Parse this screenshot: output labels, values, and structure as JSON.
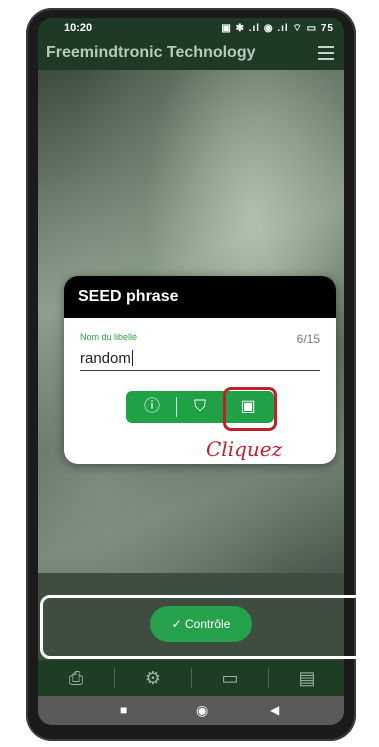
{
  "status_bar": {
    "time": "10:20",
    "icons_text": "▣ ✱ .ıl ◉ .ıl ⌔ ▭ 75"
  },
  "app_bar": {
    "title": "Freemindtronic Technology",
    "menu_icon": "hamburger-menu-icon"
  },
  "dialog": {
    "title": "SEED phrase",
    "field_label": "Nom du libellé",
    "field_counter": "6/15",
    "field_value": "random",
    "buttons": [
      {
        "icon": "info-icon",
        "glyph": "ⓘ"
      },
      {
        "icon": "shield-check-icon",
        "glyph": "⛉"
      },
      {
        "icon": "save-icon",
        "glyph": "▣"
      }
    ]
  },
  "annotation": {
    "text": "Cliquez",
    "color": "#c0202a"
  },
  "controle_button": {
    "label": "Contrôle",
    "icon": "checkmark-icon",
    "glyph": "✓"
  },
  "bottom_nav": [
    {
      "icon": "printer-icon",
      "glyph": "⎙"
    },
    {
      "icon": "gear-icon",
      "glyph": "⚙"
    },
    {
      "icon": "devices-icon",
      "glyph": "▭"
    },
    {
      "icon": "document-search-icon",
      "glyph": "▤"
    }
  ],
  "system_nav": [
    {
      "icon": "recent-apps-icon",
      "glyph": "■"
    },
    {
      "icon": "home-icon",
      "glyph": "◉"
    },
    {
      "icon": "back-icon",
      "glyph": "◀"
    }
  ],
  "colors": {
    "accent_green": "#20a145",
    "app_bar": "#1e3a24",
    "annotation_red": "#c0202a"
  }
}
